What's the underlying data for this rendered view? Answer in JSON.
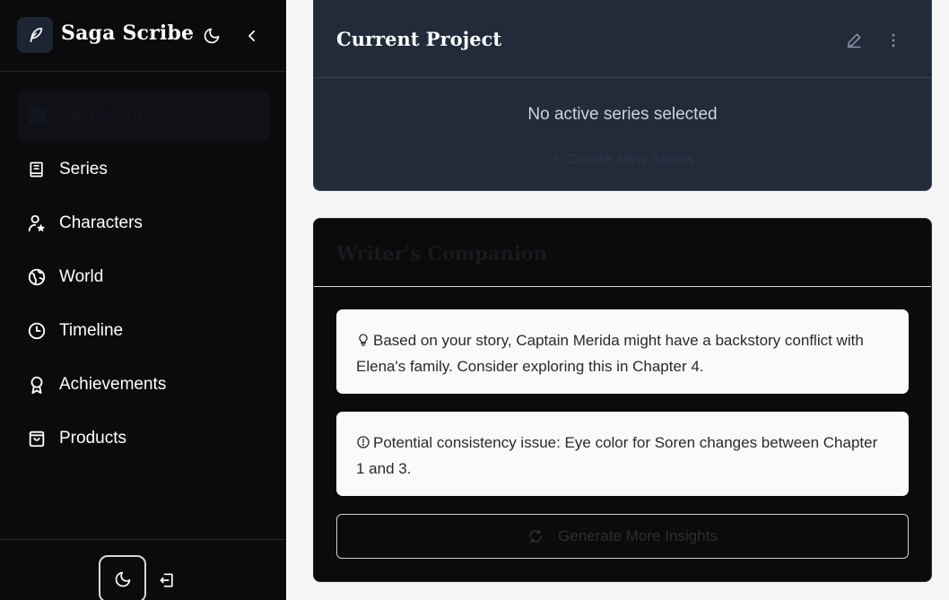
{
  "app": {
    "name": "Saga Scribe"
  },
  "sidebar": {
    "items": [
      {
        "label": "Dashboard",
        "icon": "dashboard-grid-icon",
        "active": true
      },
      {
        "label": "Series",
        "icon": "book-icon"
      },
      {
        "label": "Characters",
        "icon": "user-star-icon"
      },
      {
        "label": "World",
        "icon": "globe-icon"
      },
      {
        "label": "Timeline",
        "icon": "clock-icon"
      },
      {
        "label": "Achievements",
        "icon": "award-icon"
      },
      {
        "label": "Products",
        "icon": "shopping-bag-icon"
      }
    ]
  },
  "current_project": {
    "title": "Current Project",
    "empty_text": "No active series selected",
    "create_plus": "+",
    "create_label": "Create New Series"
  },
  "companion": {
    "title": "Writer's Companion",
    "insights": [
      {
        "icon": "lightbulb-icon",
        "text": "Based on your story, Captain Merida might have a backstory conflict with Elena's family. Consider exploring this in Chapter 4."
      },
      {
        "icon": "alert-circle-icon",
        "text": "Potential consistency issue: Eye color for Soren changes between Chapter 1 and 3."
      }
    ],
    "generate_label": "Generate More Insights"
  },
  "colors": {
    "sidebar_bg": "#0b0b0d",
    "project_card_bg": "#222b3a",
    "main_bg": "#f6f6f7",
    "insight_bg": "#fafafa"
  }
}
